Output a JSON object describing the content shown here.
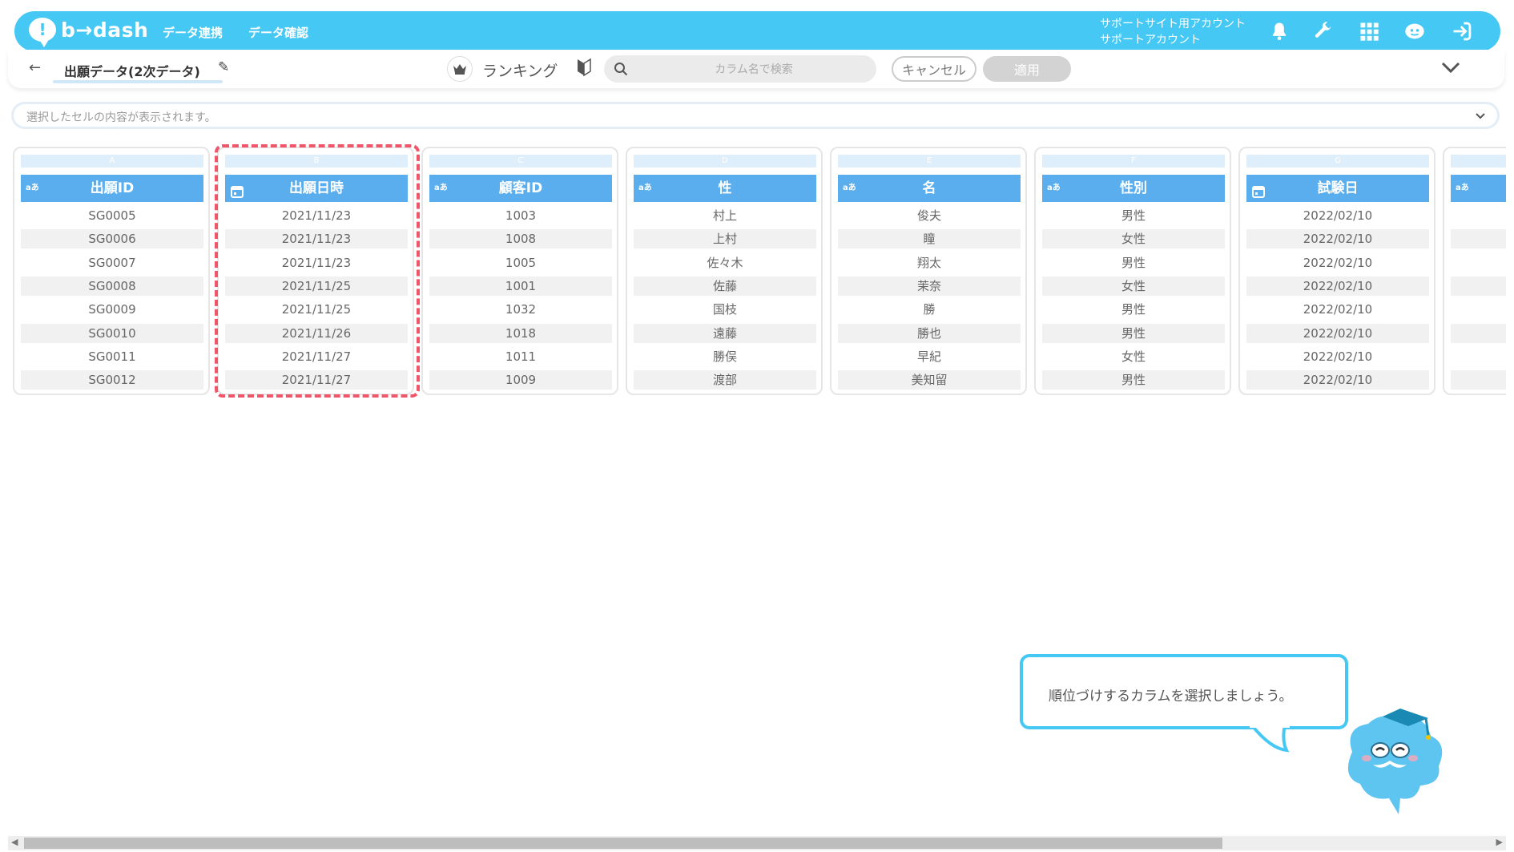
{
  "app": {
    "logo_text": "b→dash",
    "nav": [
      "データ連携",
      "データ確認"
    ],
    "account_line1": "サポートサイト用アカウント",
    "account_line2": "サポートアカウント"
  },
  "toolbar": {
    "data_name": "出願データ(2次データ)",
    "mode_label": "ランキング",
    "search_placeholder": "カラム名で検索",
    "cancel_label": "キャンセル",
    "apply_label": "適用"
  },
  "cellbar": {
    "placeholder": "選択したセルの内容が表示されます。"
  },
  "table": {
    "columns": [
      {
        "letter": "A",
        "type": "text",
        "header": "出願ID",
        "cells": [
          "SG0005",
          "SG0006",
          "SG0007",
          "SG0008",
          "SG0009",
          "SG0010",
          "SG0011",
          "SG0012"
        ]
      },
      {
        "letter": "B",
        "type": "date",
        "header": "出願日時",
        "cells": [
          "2021/11/23",
          "2021/11/23",
          "2021/11/23",
          "2021/11/25",
          "2021/11/25",
          "2021/11/26",
          "2021/11/27",
          "2021/11/27"
        ]
      },
      {
        "letter": "C",
        "type": "text",
        "header": "顧客ID",
        "cells": [
          "1003",
          "1008",
          "1005",
          "1001",
          "1032",
          "1018",
          "1011",
          "1009"
        ]
      },
      {
        "letter": "D",
        "type": "text",
        "header": "性",
        "cells": [
          "村上",
          "上村",
          "佐々木",
          "佐藤",
          "国枝",
          "遠藤",
          "勝俣",
          "渡部"
        ]
      },
      {
        "letter": "E",
        "type": "text",
        "header": "名",
        "cells": [
          "俊夫",
          "瞳",
          "翔太",
          "茉奈",
          "勝",
          "勝也",
          "早紀",
          "美知留"
        ]
      },
      {
        "letter": "F",
        "type": "text",
        "header": "性別",
        "cells": [
          "男性",
          "女性",
          "男性",
          "女性",
          "男性",
          "男性",
          "女性",
          "男性"
        ]
      },
      {
        "letter": "G",
        "type": "date",
        "header": "試験日",
        "cells": [
          "2022/02/10",
          "2022/02/10",
          "2022/02/10",
          "2022/02/10",
          "2022/02/10",
          "2022/02/10",
          "2022/02/10",
          "2022/02/10"
        ]
      },
      {
        "letter": "",
        "type": "text",
        "header": "",
        "cells": [
          "",
          "",
          "",
          "",
          "",
          "",
          "",
          ""
        ]
      }
    ],
    "type_text_icon": "aあ",
    "letter_color": "#deeefa",
    "header_color": "#5aaeed",
    "highlighted_column": "B"
  },
  "guide": {
    "message": "順位づけするカラムを選択しましょう。"
  },
  "colors": {
    "brand": "#46c8f5",
    "highlight": "#f0566a"
  }
}
